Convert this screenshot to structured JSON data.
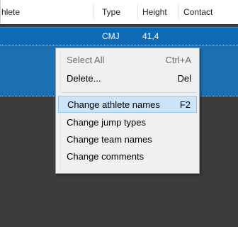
{
  "grid": {
    "columns": [
      {
        "key": "athlete",
        "label": "hlete"
      },
      {
        "key": "type",
        "label": "Type"
      },
      {
        "key": "height",
        "label": "Height"
      },
      {
        "key": "contact",
        "label": "Contact"
      }
    ],
    "selected_row": {
      "type": "CMJ",
      "height": "41,4"
    }
  },
  "context_menu": {
    "items": [
      {
        "label": "Select All",
        "shortcut": "Ctrl+A",
        "enabled": false
      },
      {
        "label": "Delete...",
        "shortcut": "Del",
        "enabled": true
      },
      {
        "label": "Change athlete names",
        "shortcut": "F2",
        "enabled": true,
        "highlighted": true
      },
      {
        "label": "Change jump types",
        "shortcut": "",
        "enabled": true
      },
      {
        "label": "Change team names",
        "shortcut": "",
        "enabled": true
      },
      {
        "label": "Change comments",
        "shortcut": "",
        "enabled": true
      }
    ]
  },
  "colors": {
    "selection": "#0e6ab5",
    "menu_highlight": "#cce4f7",
    "background": "#3c3c3c"
  }
}
